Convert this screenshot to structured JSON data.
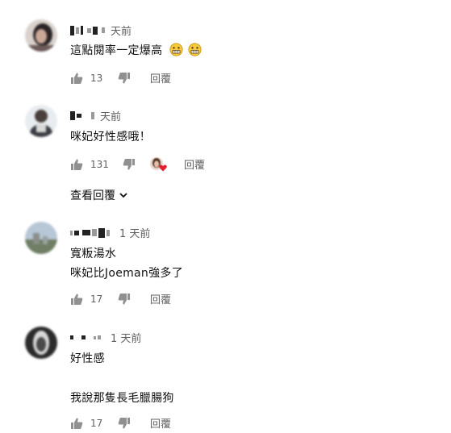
{
  "comments": [
    {
      "time": "天前",
      "text": "這點閱率一定爆高",
      "emoji_icon": "grimacing-face-icon",
      "likes": "13",
      "reply_label": "回覆"
    },
    {
      "time": "天前",
      "text": "咪妃好性感哦！",
      "likes": "131",
      "reply_label": "回覆",
      "creator_heart": "creator-heart-icon",
      "view_replies_label": "查看回覆"
    },
    {
      "time": "1 天前",
      "text_lines": [
        "寬粄湯水",
        "咪妃比Joeman強多了"
      ],
      "likes": "17",
      "reply_label": "回覆"
    },
    {
      "time": "1 天前",
      "text_lines": [
        "好性感",
        "我說那隻長毛臘腸狗"
      ],
      "likes": "17",
      "reply_label": "回覆"
    }
  ],
  "colors": {
    "text_primary": "#0f0f0f",
    "text_secondary": "#606060",
    "heart": "#e0222c"
  }
}
